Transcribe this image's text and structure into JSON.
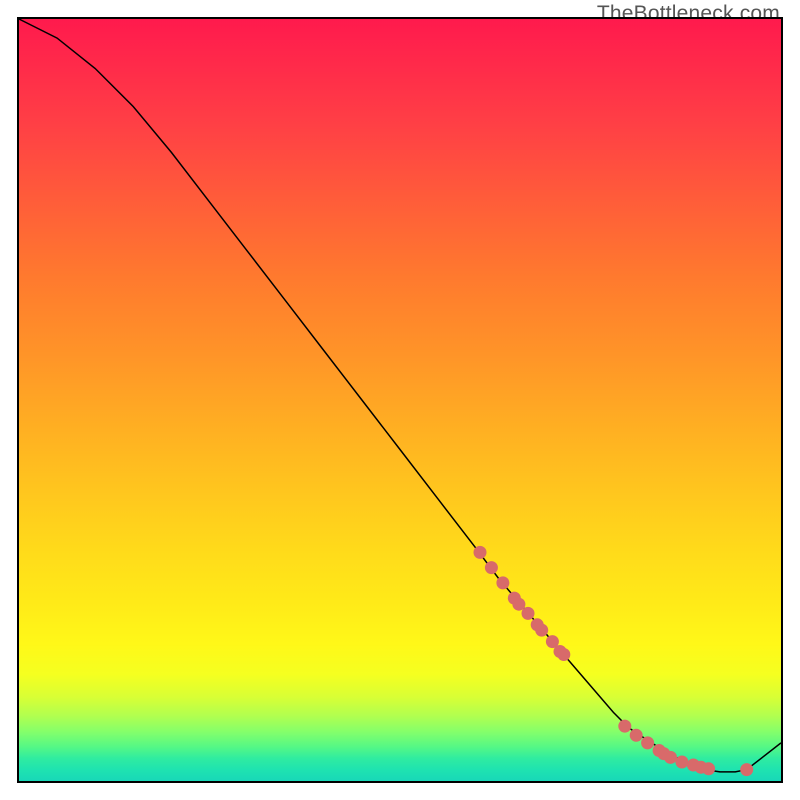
{
  "watermark": "TheBottleneck.com",
  "chart_data": {
    "type": "line",
    "title": "",
    "xlabel": "",
    "ylabel": "",
    "xlim": [
      0,
      100
    ],
    "ylim": [
      0,
      100
    ],
    "grid": false,
    "series": [
      {
        "name": "curve",
        "x": [
          0,
          5,
          10,
          15,
          20,
          25,
          30,
          35,
          40,
          45,
          50,
          55,
          60,
          63,
          66,
          69,
          72,
          75,
          78,
          80,
          83,
          86,
          88,
          90,
          92,
          94,
          95.5,
          100
        ],
        "y": [
          100,
          97.5,
          93.5,
          88.5,
          82.5,
          76,
          69.5,
          63,
          56.5,
          50,
          43.5,
          37,
          30.5,
          26.5,
          23,
          19.5,
          16,
          12.5,
          9,
          7,
          5,
          3.2,
          2.2,
          1.5,
          1.2,
          1.2,
          1.5,
          5
        ]
      }
    ],
    "markers": {
      "name": "highlighted-points",
      "color": "#d86a6a",
      "x": [
        60.5,
        62,
        63.5,
        65,
        65.6,
        66.8,
        68,
        68.6,
        70,
        71,
        71.5,
        79.5,
        81,
        82.5,
        84,
        84.6,
        85.5,
        87,
        88.5,
        89.5,
        90.5,
        95.5
      ],
      "y": [
        30,
        28,
        26,
        24,
        23.2,
        22,
        20.5,
        19.8,
        18.3,
        17,
        16.6,
        7.2,
        6,
        5,
        4,
        3.6,
        3.1,
        2.5,
        2.1,
        1.8,
        1.6,
        1.5
      ]
    },
    "background_gradient": {
      "type": "vertical",
      "stops": [
        {
          "pos": 0.0,
          "color": "#ff1a4d"
        },
        {
          "pos": 0.5,
          "color": "#ffb022"
        },
        {
          "pos": 0.82,
          "color": "#fff818"
        },
        {
          "pos": 1.0,
          "color": "#18d8b8"
        }
      ]
    }
  }
}
